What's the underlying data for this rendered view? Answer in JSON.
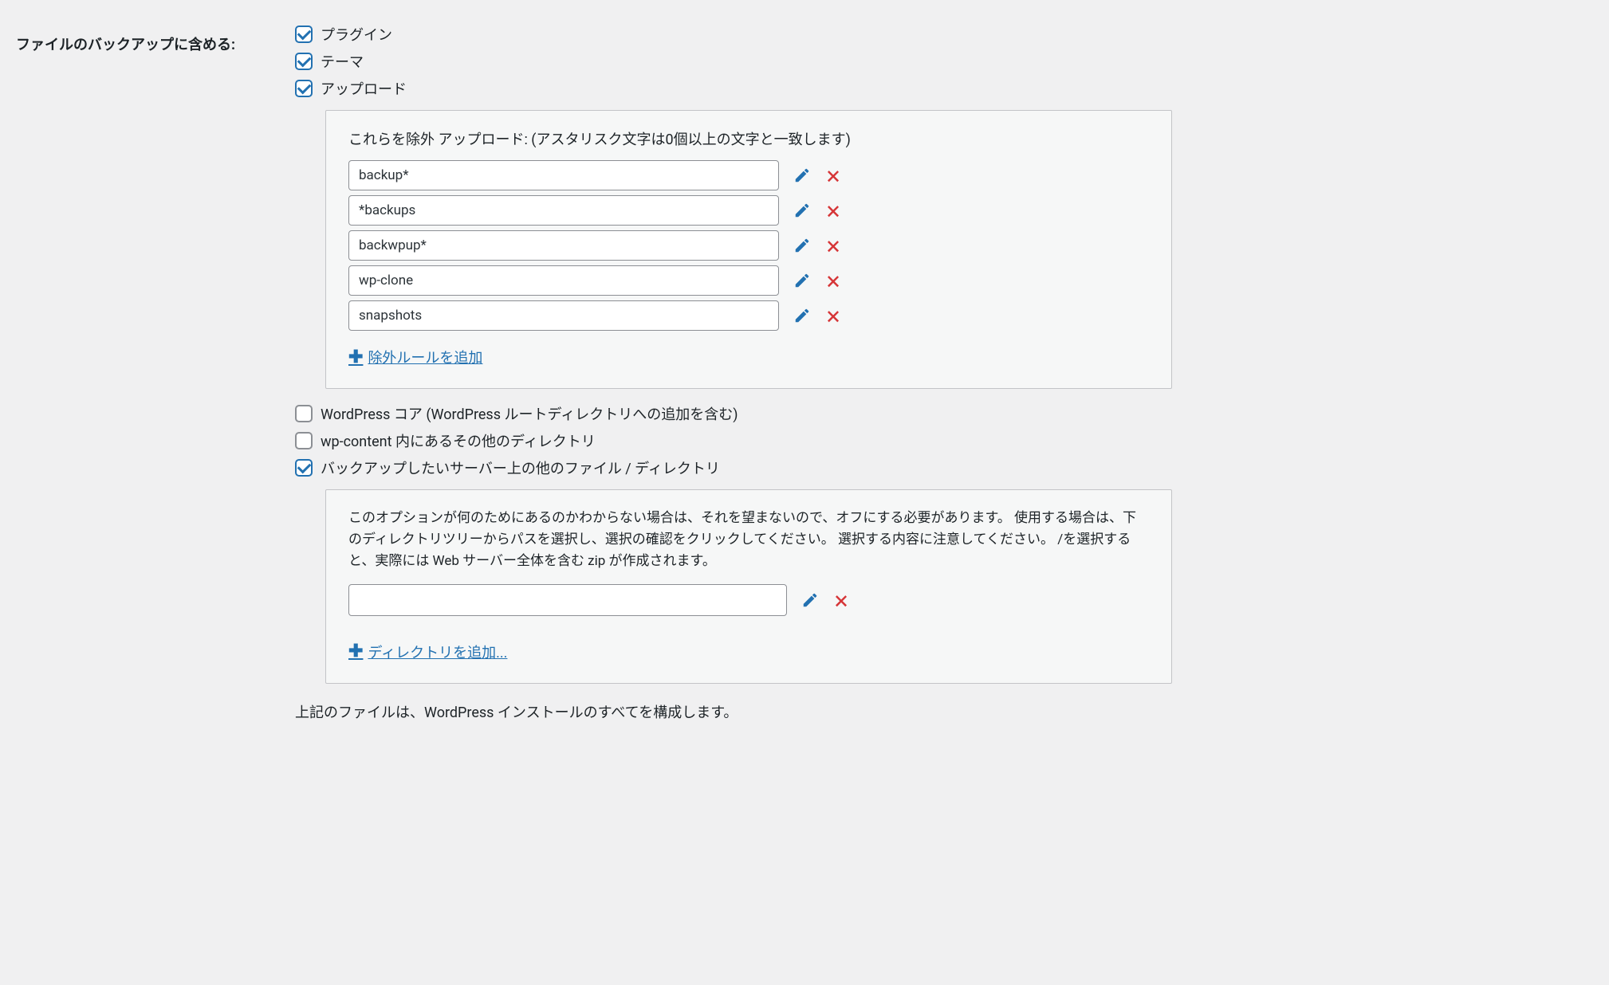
{
  "section_label": "ファイルのバックアップに含める:",
  "checkboxes": {
    "plugins": {
      "label": "プラグイン",
      "checked": true
    },
    "themes": {
      "label": "テーマ",
      "checked": true
    },
    "uploads": {
      "label": "アップロード",
      "checked": true
    },
    "wp_core": {
      "label": "WordPress コア (WordPress ルートディレクトリへの追加を含む)",
      "checked": false
    },
    "wp_content_other": {
      "label": "wp-content 内にあるその他のディレクトリ",
      "checked": false
    },
    "other_server_files": {
      "label": "バックアップしたいサーバー上の他のファイル / ディレクトリ",
      "checked": true
    }
  },
  "exclude_panel": {
    "heading_prefix": "これらを除外 アップロード:",
    "heading_hint": "(アスタリスク文字は0個以上の文字と一致します)",
    "rules": [
      {
        "value": "backup*"
      },
      {
        "value": "*backups"
      },
      {
        "value": "backwpup*"
      },
      {
        "value": "wp-clone"
      },
      {
        "value": "snapshots"
      }
    ],
    "add_link_label": "除外ルールを追加"
  },
  "other_files_panel": {
    "description": "このオプションが何のためにあるのかわからない場合は、それを望まないので、オフにする必要があります。 使用する場合は、下のディレクトリツリーからパスを選択し、選択の確認をクリックしてください。 選択する内容に注意してください。 /を選択すると、実際には Web サーバー全体を含む zip が作成されます。",
    "path_value": "",
    "add_link_label": "ディレクトリを追加..."
  },
  "footer_note": "上記のファイルは、WordPress インストールのすべてを構成します。"
}
